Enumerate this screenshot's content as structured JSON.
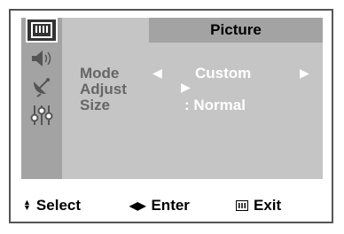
{
  "header": {
    "title": "Picture"
  },
  "sidebar": {
    "items": [
      {
        "icon": "picture-menu-icon",
        "active": true
      },
      {
        "icon": "sound-speaker-icon",
        "active": false
      },
      {
        "icon": "channel-satellite-dish-icon",
        "active": false
      },
      {
        "icon": "setup-sliders-icon",
        "active": false
      },
      {
        "icon": "empty-slot",
        "active": false
      }
    ]
  },
  "settings": {
    "mode": {
      "label": "Mode",
      "value": "Custom"
    },
    "adjust": {
      "label": "Adjust"
    },
    "size": {
      "label": "Size",
      "value": ": Normal"
    }
  },
  "footer": {
    "select_label": "Select",
    "enter_label": "Enter",
    "exit_label": "Exit"
  },
  "colors": {
    "panel": "#c5c5c5",
    "sidebar": "#a3a3a3",
    "active_slot": "#333333",
    "value_text": "#ffffff",
    "label_text": "#666666"
  }
}
